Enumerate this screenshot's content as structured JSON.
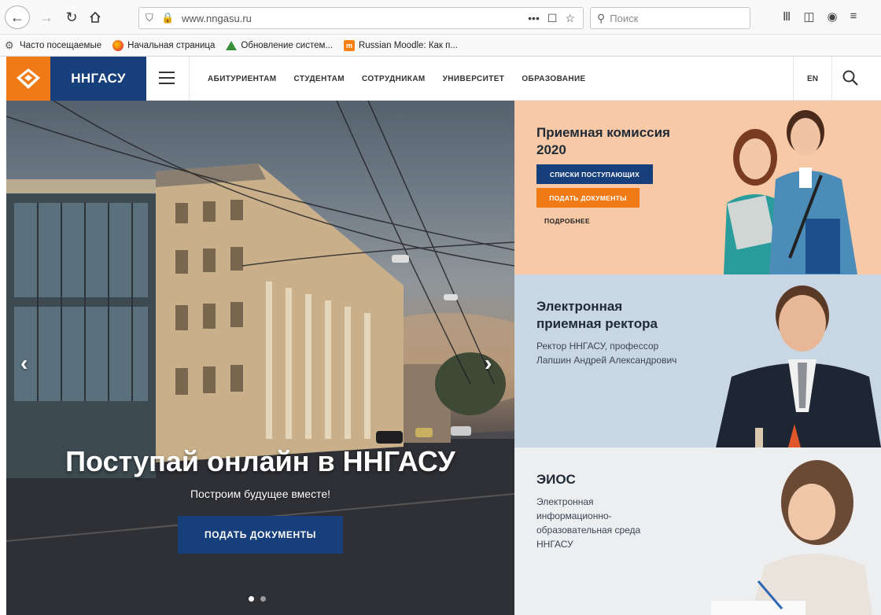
{
  "browser": {
    "url": "www.nngasu.ru",
    "search_placeholder": "Поиск",
    "bookmarks": [
      {
        "label": "Часто посещаемые",
        "icon": "gear-icon"
      },
      {
        "label": "Начальная страница",
        "icon": "firefox-icon"
      },
      {
        "label": "Обновление систем...",
        "icon": "triangle-icon"
      },
      {
        "label": "Russian Moodle: Как п...",
        "icon": "moodle-icon"
      }
    ]
  },
  "header": {
    "brand": "ННГАСУ",
    "nav": [
      "АБИТУРИЕНТАМ",
      "СТУДЕНТАМ",
      "СОТРУДНИКАМ",
      "УНИВЕРСИТЕТ",
      "ОБРАЗОВАНИЕ"
    ],
    "lang": "EN"
  },
  "hero": {
    "title": "Поступай онлайн в ННГАСУ",
    "subtitle": "Построим будущее вместе!",
    "button": "ПОДАТЬ ДОКУМЕНТЫ",
    "arrow_left": "‹",
    "arrow_right": "›"
  },
  "panels": {
    "admission": {
      "title": "Приемная комиссия 2020",
      "btn_lists": "СПИСКИ ПОСТУПАЮЩИХ",
      "btn_submit": "ПОДАТЬ ДОКУМЕНТЫ",
      "more": "ПОДРОБНЕЕ"
    },
    "rector": {
      "title": "Электронная приемная ректора",
      "text": "Ректор ННГАСУ, профессор Лапшин Андрей Александрович"
    },
    "eios": {
      "title": "ЭИОС",
      "text": "Электронная информационно-образовательная среда ННГАСУ"
    }
  },
  "colors": {
    "brand_blue": "#163f7c",
    "brand_orange": "#f07b16",
    "admission_bg": "#f7c9a6",
    "rector_bg": "#c9d6e3",
    "eios_bg": "#eceef0"
  }
}
